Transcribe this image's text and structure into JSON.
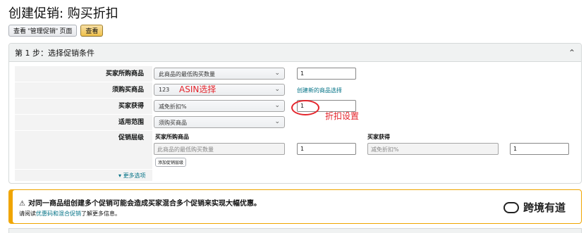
{
  "page": {
    "title": "创建促销: 购买折扣"
  },
  "toolbar": {
    "manage_label": "查看 \"管理促销\" 页面",
    "view_label": "查看"
  },
  "panel": {
    "step_title": "第 1 步：选择促销条件"
  },
  "rows": {
    "buyer_purchases": {
      "label": "买家所购商品",
      "select_value": "此商品的最低购买数量",
      "input_value": "1"
    },
    "required_item": {
      "label": "须购买商品",
      "select_value": "123",
      "link": "创建新的商品选择"
    },
    "buyer_gets": {
      "label": "买家获得",
      "select_value": "减免折扣%",
      "input_value": "1"
    },
    "applies_to": {
      "label": "适用范围",
      "select_value": "须购买商品"
    },
    "tiers": {
      "label": "促销层级",
      "col1_header": "买家所购商品",
      "col2_header": "买家获得",
      "col1_placeholder": "此商品的最低购买数量",
      "col1_value": "1",
      "col2_placeholder": "减免折扣%",
      "col2_value": "1",
      "add_tier": "添加促销层级"
    },
    "more_options": "更多选项"
  },
  "annotations": {
    "asin": "ASIN选择",
    "discount": "折扣设置",
    "color": "#e4242b"
  },
  "alert": {
    "title": "对同一商品组创建多个促销可能会造成买家混合多个促销来实现大幅优惠。",
    "body_prefix": "请阅读",
    "body_link": "优惠码和混合促销",
    "body_suffix": "了解更多信息。",
    "watermark": "跨境有道",
    "border_color": "#f0a500"
  }
}
